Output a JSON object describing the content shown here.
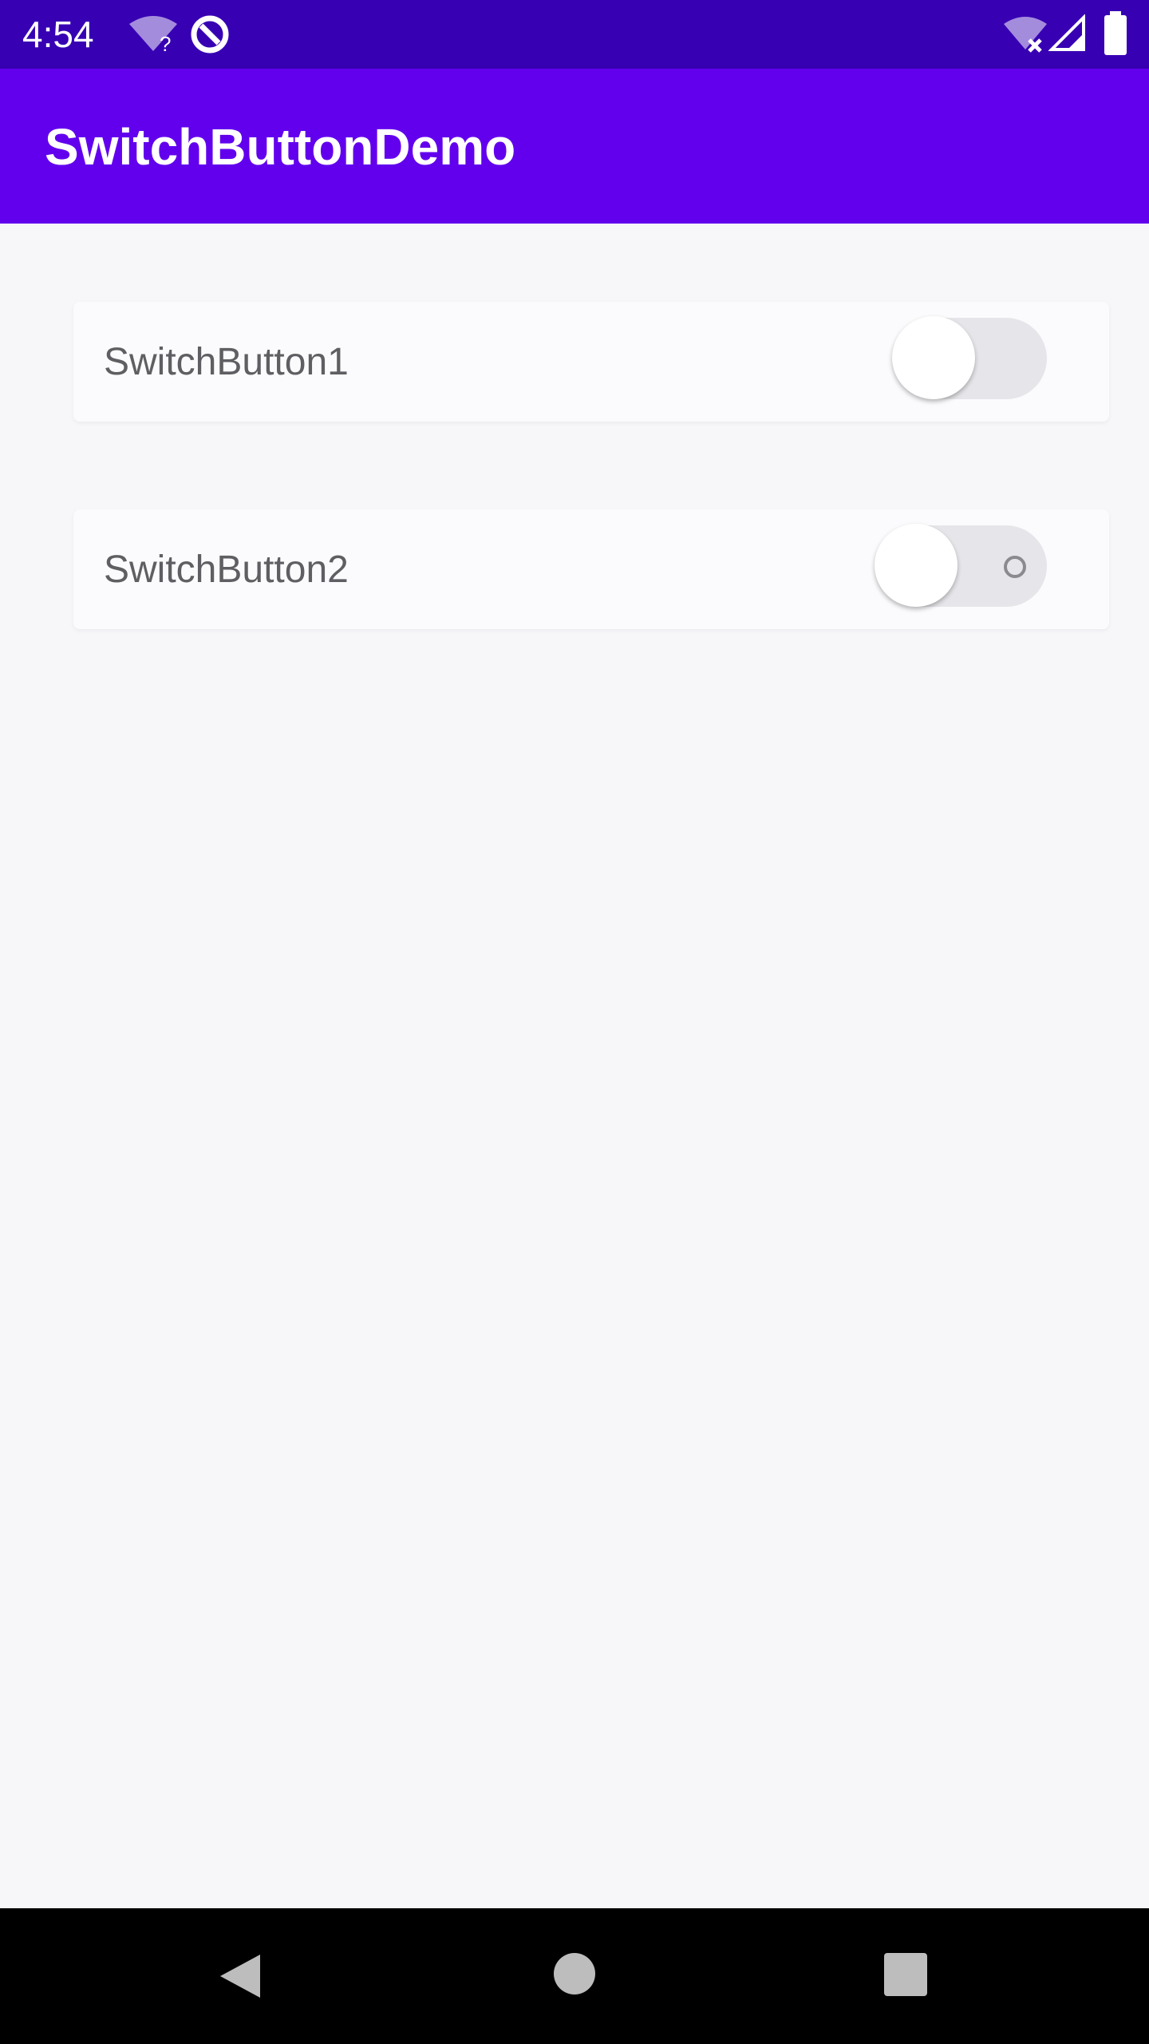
{
  "status_bar": {
    "time": "4:54",
    "icons": [
      "wifi-unknown-icon",
      "data-saver-icon",
      "wifi-off-icon",
      "cell-signal-icon",
      "battery-icon"
    ]
  },
  "app_bar": {
    "title": "SwitchButtonDemo"
  },
  "switches": [
    {
      "label": "SwitchButton1",
      "checked": false
    },
    {
      "label": "SwitchButton2",
      "checked": false
    }
  ],
  "nav_bar": {
    "buttons": [
      "back-icon",
      "home-icon",
      "recents-icon"
    ]
  },
  "colors": {
    "status_bar": "#3700b3",
    "app_bar": "#6200ee",
    "background": "#f7f7fa",
    "track_off": "#e6e6ea",
    "thumb": "#ffffff",
    "label": "#5f5f63"
  }
}
